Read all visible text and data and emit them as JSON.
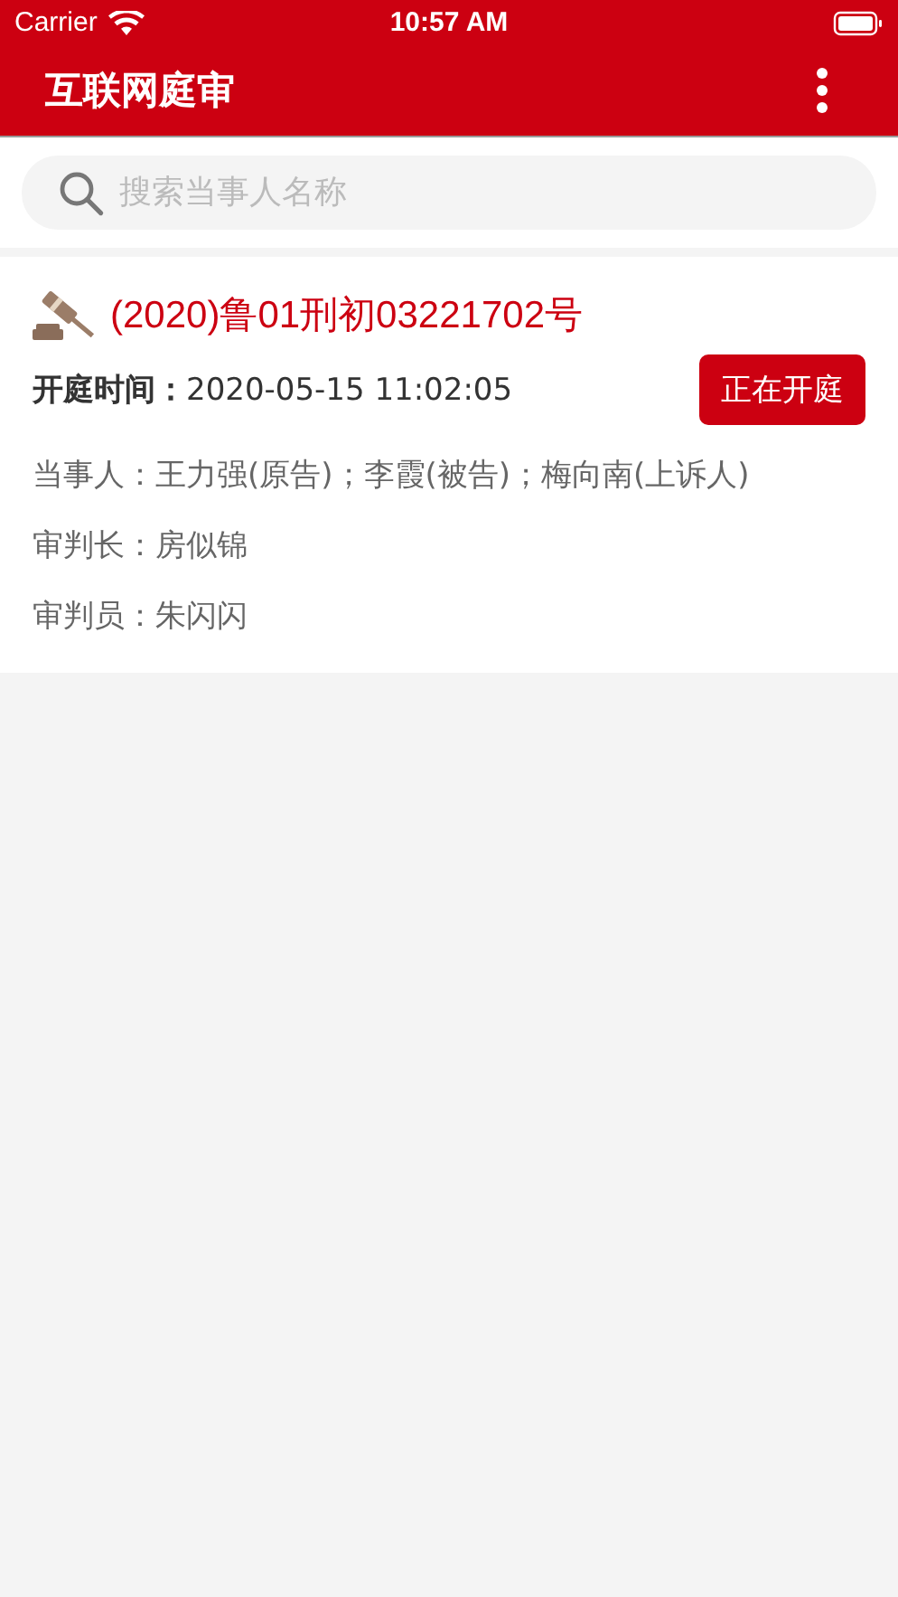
{
  "status_bar": {
    "carrier": "Carrier",
    "time": "10:57 AM"
  },
  "nav": {
    "title": "互联网庭审"
  },
  "search": {
    "placeholder": "搜索当事人名称"
  },
  "cases": [
    {
      "number": "(2020)鲁01刑初03221702号",
      "session_time": "**开庭时间：**2020-05-15 11:02:05",
      "status": "正在开庭",
      "details": [
        "当事人：王力强(原告)；李霞(被告)；梅向南(上诉人)",
        "审判长：房似锦",
        "审判员：朱闪闪"
      ]
    }
  ]
}
